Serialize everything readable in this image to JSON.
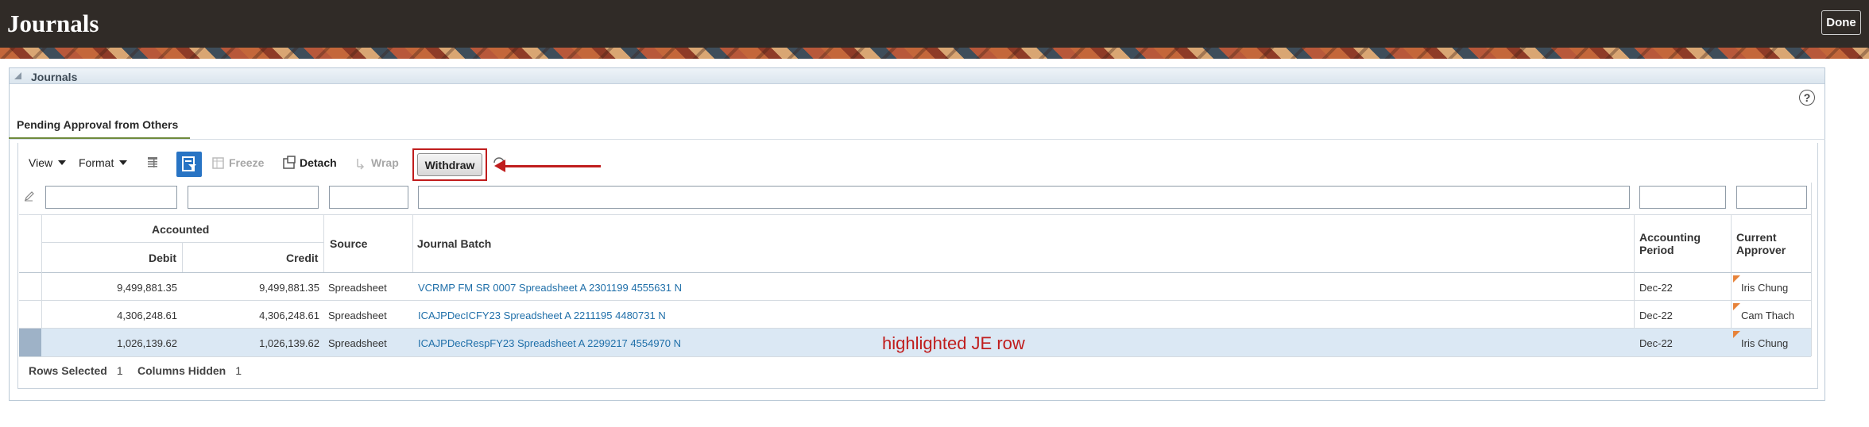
{
  "app": {
    "title": "Journals",
    "done_label": "Done"
  },
  "panel": {
    "title": "Journals",
    "tab_label": "Pending Approval from Others",
    "help_glyph": "?"
  },
  "toolbar": {
    "view_label": "View",
    "format_label": "Format",
    "freeze_label": "Freeze",
    "detach_label": "Detach",
    "wrap_label": "Wrap",
    "withdraw_label": "Withdraw"
  },
  "table": {
    "group_header": "Accounted",
    "columns": {
      "debit": "Debit",
      "credit": "Credit",
      "source": "Source",
      "journal_batch": "Journal Batch",
      "accounting_period_line1": "Accounting",
      "accounting_period_line2": "Period",
      "current_approver_line1": "Current",
      "current_approver_line2": "Approver"
    },
    "rows": [
      {
        "debit": "9,499,881.35",
        "credit": "9,499,881.35",
        "source": "Spreadsheet",
        "batch": "VCRMP FM SR 0007 Spreadsheet A 2301199 4555631 N",
        "period": "Dec-22",
        "approver": "Iris Chung",
        "selected": false
      },
      {
        "debit": "4,306,248.61",
        "credit": "4,306,248.61",
        "source": "Spreadsheet",
        "batch": "ICAJPDecICFY23 Spreadsheet A 2211195 4480731 N",
        "period": "Dec-22",
        "approver": "Cam Thach",
        "selected": false
      },
      {
        "debit": "1,026,139.62",
        "credit": "1,026,139.62",
        "source": "Spreadsheet",
        "batch": "ICAJPDecRespFY23 Spreadsheet A 2299217 4554970 N",
        "period": "Dec-22",
        "approver": "Iris Chung",
        "selected": true
      }
    ]
  },
  "annotation": "highlighted JE row",
  "status": {
    "rows_selected_label": "Rows Selected",
    "rows_selected_value": "1",
    "columns_hidden_label": "Columns Hidden",
    "columns_hidden_value": "1"
  },
  "colors": {
    "header_bg": "#302b27",
    "accent_red": "#c01d1d",
    "link_blue": "#1f6fa9",
    "selected_row": "#dbe8f4",
    "tab_underline": "#6f8a3c"
  }
}
